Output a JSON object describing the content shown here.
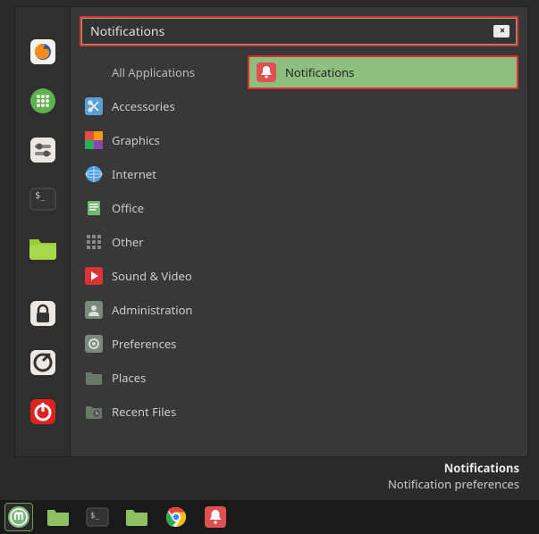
{
  "search": {
    "value": "Notifications"
  },
  "categories": {
    "all": "All Applications",
    "accessories": "Accessories",
    "graphics": "Graphics",
    "internet": "Internet",
    "office": "Office",
    "other": "Other",
    "sound": "Sound & Video",
    "admin": "Administration",
    "prefs": "Preferences",
    "places": "Places",
    "recent": "Recent Files"
  },
  "result": {
    "label": "Notifications"
  },
  "tooltip": {
    "title": "Notifications",
    "desc": "Notification preferences"
  }
}
